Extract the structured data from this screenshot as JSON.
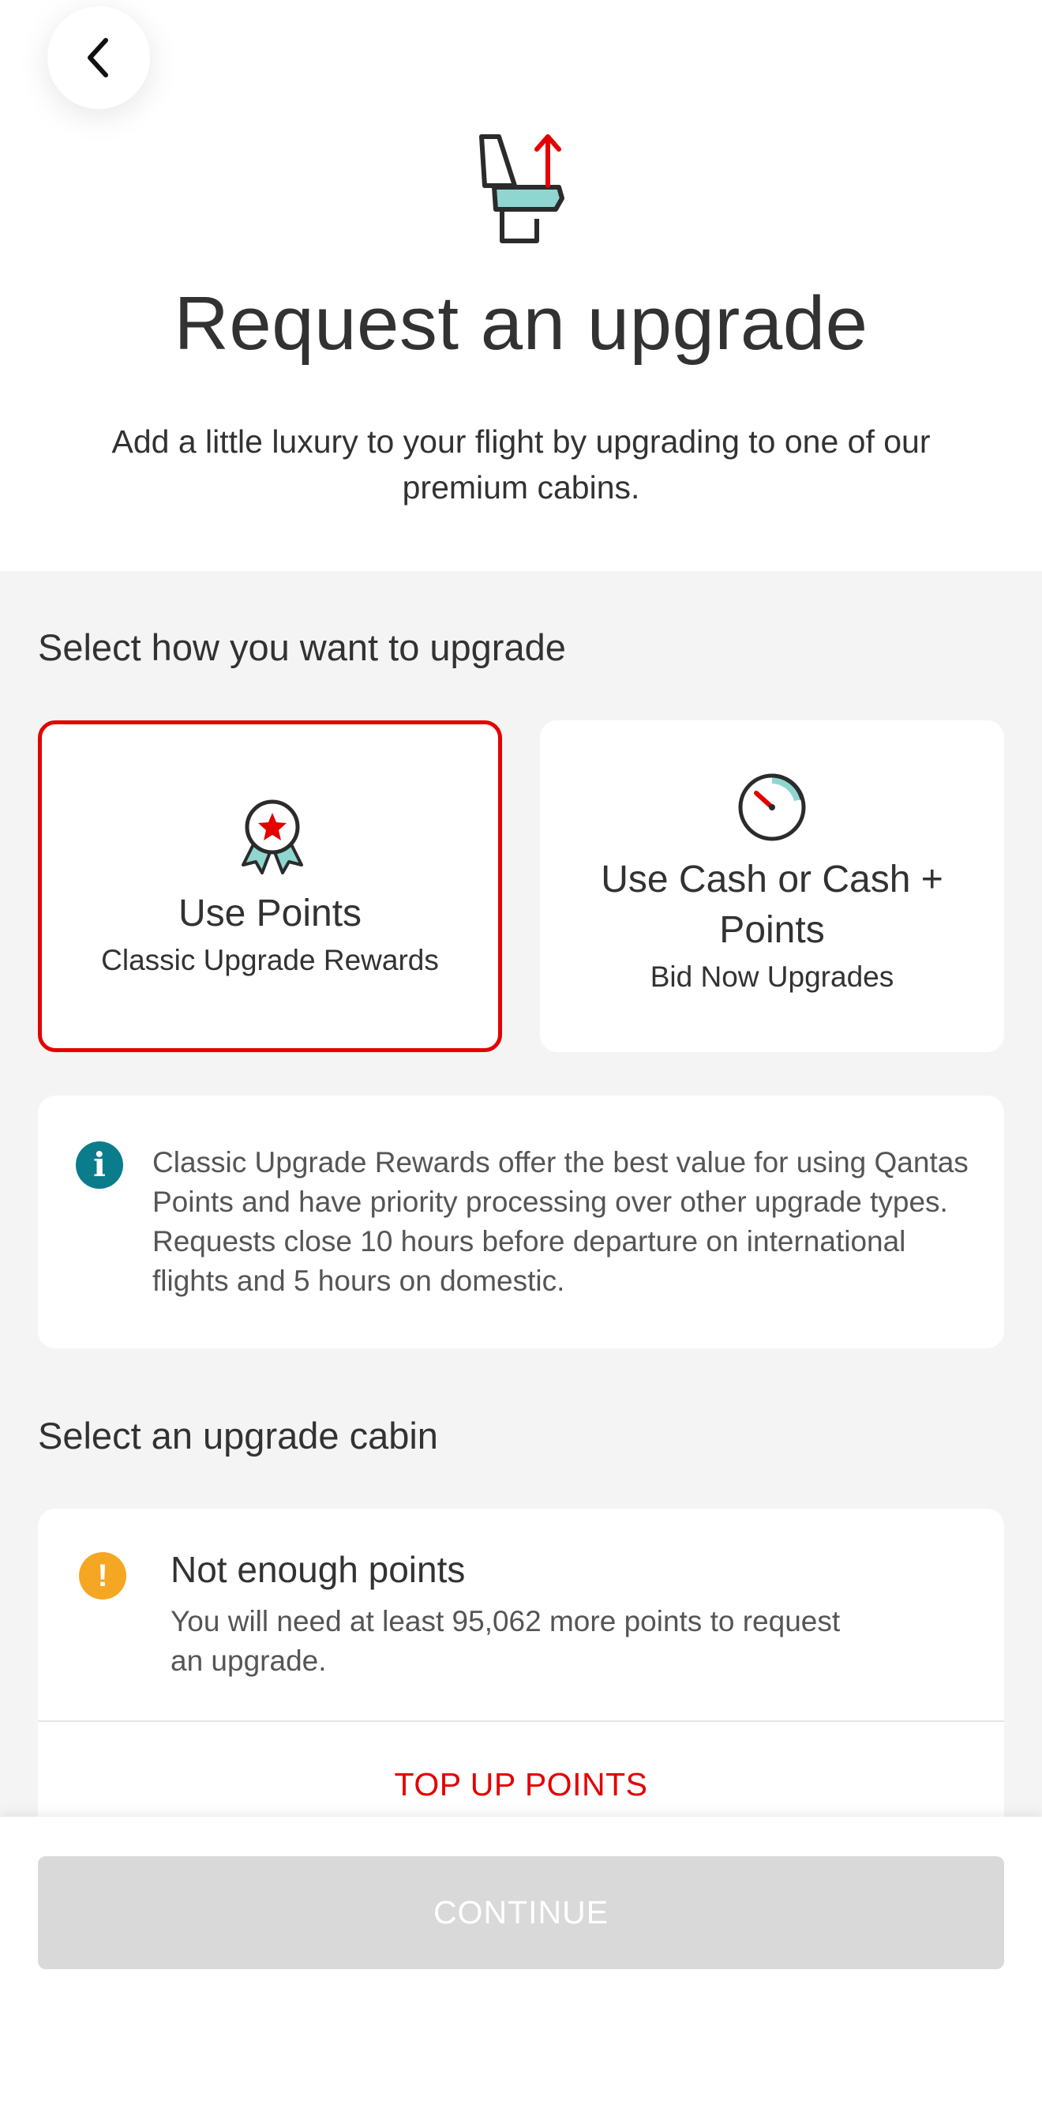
{
  "header": {
    "back_icon": "chevron-left-icon",
    "hero_icon": "seat-upgrade-icon",
    "title": "Request an upgrade",
    "subtitle": "Add a little luxury to your flight by upgrading to one of our premium cabins."
  },
  "upgrade_method": {
    "heading": "Select how you want to upgrade",
    "options": [
      {
        "icon": "award-ribbon-icon",
        "title": "Use Points",
        "subtitle": "Classic Upgrade Rewards",
        "selected": true
      },
      {
        "icon": "timer-gauge-icon",
        "title": "Use Cash or Cash + Points",
        "subtitle": "Bid Now Upgrades",
        "selected": false
      }
    ]
  },
  "info": {
    "icon": "info-icon",
    "text": "Classic Upgrade Rewards offer the best value for using Qantas Points and have priority processing over other upgrade types. Requests close 10 hours before departure on international flights and 5 hours on domestic."
  },
  "cabin": {
    "heading": "Select an upgrade cabin",
    "warning_icon": "warning-icon",
    "warning_title": "Not enough points",
    "warning_text": "You will need at least 95,062 more points to request an upgrade.",
    "top_up_label": "TOP UP POINTS"
  },
  "footer": {
    "continue_label": "CONTINUE",
    "continue_enabled": false
  },
  "colors": {
    "brand_red": "#e40000",
    "info_teal": "#0a7c8c",
    "warning_amber": "#f5a623",
    "seat_mint": "#8fd6d0",
    "disabled_grey": "#d9d9d9"
  }
}
